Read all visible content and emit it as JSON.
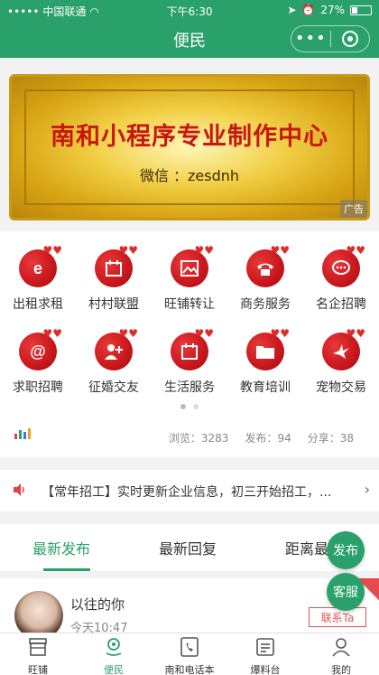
{
  "status_bar": {
    "carrier": "中国联通",
    "time": "下午6:30",
    "battery": "27%"
  },
  "nav": {
    "title": "便民",
    "more_icon": "more-dots-icon",
    "close_icon": "close-ring-icon"
  },
  "banner": {
    "title": "南和小程序专业制作中心",
    "subtitle": "微信 ：zesdnh",
    "ad_label": "广告"
  },
  "grid": [
    {
      "label": "出租求租",
      "icon": "ie-icon"
    },
    {
      "label": "村村联盟",
      "icon": "calendar-icon"
    },
    {
      "label": "旺铺转让",
      "icon": "picture-icon"
    },
    {
      "label": "商务服务",
      "icon": "phone-icon"
    },
    {
      "label": "名企招聘",
      "icon": "chat-icon"
    },
    {
      "label": "求职招聘",
      "icon": "at-icon"
    },
    {
      "label": "征婚交友",
      "icon": "add-user-icon"
    },
    {
      "label": "生活服务",
      "icon": "calendar-icon"
    },
    {
      "label": "教育培训",
      "icon": "folder-icon"
    },
    {
      "label": "宠物交易",
      "icon": "bird-icon"
    }
  ],
  "stats": {
    "views": "浏览：3283",
    "posts": "发布：94",
    "shares": "分享：38"
  },
  "notice": {
    "text": "【常年招工】实时更新企业信息，初三开始招工，..."
  },
  "tabs": [
    {
      "label": "最新发布",
      "active": true
    },
    {
      "label": "最新回复",
      "active": false
    },
    {
      "label": "距离最",
      "active": false
    }
  ],
  "post": {
    "name": "以往的你",
    "time": "今天10:47",
    "contact_label": "联系Ta"
  },
  "floating": {
    "publish": "发布",
    "service": "客服"
  },
  "tabbar": [
    {
      "label": "旺铺",
      "icon": "shop-icon",
      "active": false
    },
    {
      "label": "便民",
      "icon": "location-icon",
      "active": true
    },
    {
      "label": "南和电话本",
      "icon": "phonebook-icon",
      "active": false
    },
    {
      "label": "爆料台",
      "icon": "news-icon",
      "active": false
    },
    {
      "label": "我的",
      "icon": "user-icon",
      "active": false
    }
  ],
  "colors": {
    "brand_green": "#2aa06b",
    "grid_red": "#c8171c",
    "gold": "#f1cf45"
  }
}
